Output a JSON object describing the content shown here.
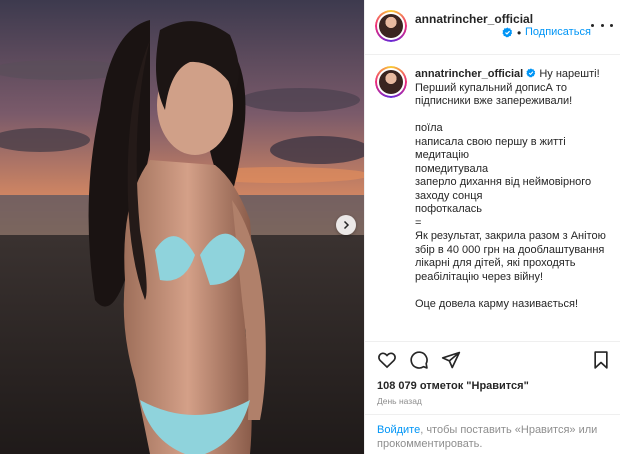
{
  "header": {
    "username": "annatrincher_official",
    "dot": "•",
    "follow_label": "Подписаться"
  },
  "caption": {
    "username": "annatrincher_official",
    "text": "Ну нарешті!\nПерший купальний дописА то підписники вже запереживали!\n\nпоїла\nнаписала свою першу в житті медитацію\nпомедитувала\nзаперло дихання від неймовірного заходу сонця\nпофоткалась\n=\nЯк результат, закрила разом з Анітою збір в 40 000 грн на дооблаштування лікарні для дітей, які проходять реабілітацію через війну!\n\nОце довела карму називається!"
  },
  "stats": {
    "likes": "108 079 отметок \"Нравится\"",
    "time_ago": "День назад"
  },
  "login_prompt": {
    "link": "Войдите",
    "rest": ", чтобы поставить «Нравится» или прокомментировать."
  },
  "icons": {
    "like": "heart-icon",
    "comment": "comment-icon",
    "share": "share-icon",
    "save": "bookmark-icon",
    "more": "more-icon",
    "next": "chevron-right-icon",
    "verified": "verified-badge-icon"
  },
  "colors": {
    "accent": "#0095f6",
    "text": "#262626",
    "muted": "#8e8e8e",
    "border": "#efefef"
  }
}
